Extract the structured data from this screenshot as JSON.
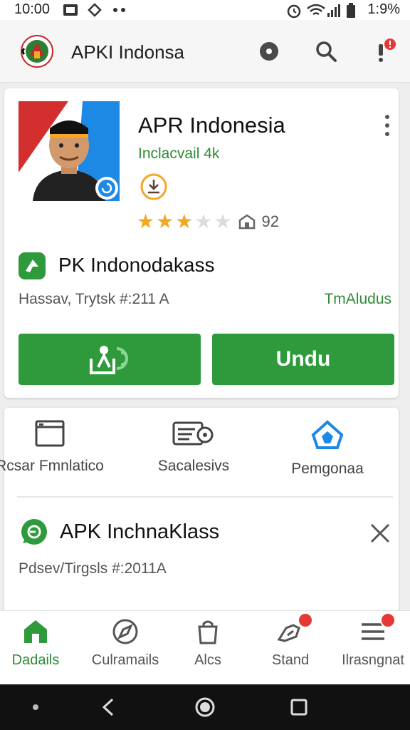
{
  "status_bar": {
    "time": "10:00",
    "battery": "1:9%",
    "icons": [
      "photo-icon",
      "transfer-icon",
      "dots-icon",
      "alarm-icon",
      "wifi-icon",
      "signal-icon",
      "battery-icon"
    ]
  },
  "app_bar": {
    "title": "APKI Indonsa",
    "icons": [
      "emblem-logo",
      "record-icon",
      "search-icon",
      "alert-icon"
    ]
  },
  "app_card": {
    "title": "APR Indonesia",
    "developer": "Inclacvail 4k",
    "rating": 3,
    "rating_max": 5,
    "rating_count": "92",
    "package_name": "PK Indonodakass",
    "meta_left": "Hassav, Trytsk #:211 A",
    "meta_right": "TmAludus",
    "install_button_icon": "install-icon",
    "download_button": "Undu"
  },
  "features": {
    "items": [
      {
        "label": "Rcsar Fmnlatico",
        "icon": "window-icon"
      },
      {
        "label": "Sacalesivs",
        "icon": "settings-card-icon"
      },
      {
        "label": "Pemgonaa",
        "icon": "home-shield-icon"
      }
    ]
  },
  "notification": {
    "title": "APK InchnaKlass",
    "meta": "Pdsev/Tirgsls #:2011A",
    "icon": "chat-icon",
    "close_icon": "close-icon"
  },
  "bottom_nav": {
    "items": [
      {
        "label": "Dadails",
        "icon": "home-icon",
        "active": true,
        "badge": false
      },
      {
        "label": "Culramails",
        "icon": "compass-icon",
        "active": false,
        "badge": false
      },
      {
        "label": "Alcs",
        "icon": "bag-icon",
        "active": false,
        "badge": false
      },
      {
        "label": "Stand",
        "icon": "hand-icon",
        "active": false,
        "badge": true
      },
      {
        "label": "Ilrasngnat",
        "icon": "menu-icon",
        "active": false,
        "badge": true
      }
    ]
  },
  "colors": {
    "accent_green": "#2e9a3c",
    "text_green": "#2e8b37",
    "star_yellow": "#f5a623",
    "badge_red": "#e53935",
    "link_blue": "#1e88e5"
  }
}
